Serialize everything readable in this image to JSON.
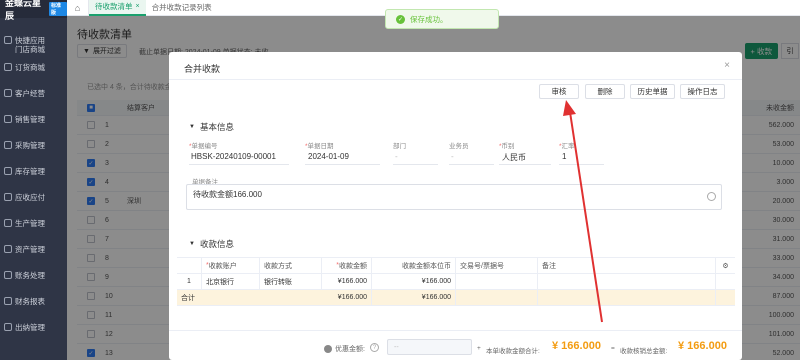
{
  "app": {
    "logo": "金蝶云星辰",
    "badge": "标准版"
  },
  "sidebar": {
    "items": [
      {
        "label": "快捷应用\n门店商城"
      },
      {
        "label": "订货商城"
      },
      {
        "label": "客户经营"
      },
      {
        "label": "销售管理"
      },
      {
        "label": "采购管理"
      },
      {
        "label": "库存管理"
      },
      {
        "label": "应收应付"
      },
      {
        "label": "生产管理"
      },
      {
        "label": "资产管理"
      },
      {
        "label": "账务处理"
      },
      {
        "label": "财务报表"
      },
      {
        "label": "出纳管理"
      }
    ]
  },
  "tabs": [
    {
      "label": "待收款清单",
      "close": "×"
    },
    {
      "label": "合并收款记录列表"
    }
  ],
  "toast": {
    "text": "保存成功。"
  },
  "background": {
    "title": "待收款清单",
    "expand_filter": "展开过滤",
    "filter_text": "截止单据日期: 2024-01-09  单据状态: 未收 ...",
    "add_btn": "+ 收款",
    "more_btn": "引",
    "selection_info": "已选中 4 条，合计待收款金额",
    "head": {
      "col_name": "结算客户",
      "col_amount": "未收金额"
    },
    "rows": [
      {
        "no": "1",
        "name": "",
        "amount": "562.000",
        "checked": false
      },
      {
        "no": "2",
        "name": "",
        "amount": "53.000",
        "checked": false
      },
      {
        "no": "3",
        "name": "",
        "amount": "10.000",
        "checked": true
      },
      {
        "no": "4",
        "name": "",
        "amount": "3.000",
        "checked": true
      },
      {
        "no": "5",
        "name": "深圳",
        "amount": "20.000",
        "checked": true
      },
      {
        "no": "6",
        "name": "",
        "amount": "30.000",
        "checked": false
      },
      {
        "no": "7",
        "name": "",
        "amount": "31.000",
        "checked": false
      },
      {
        "no": "8",
        "name": "",
        "amount": "33.000",
        "checked": false
      },
      {
        "no": "9",
        "name": "",
        "amount": "34.000",
        "checked": false
      },
      {
        "no": "10",
        "name": "",
        "amount": "87.000",
        "checked": false
      },
      {
        "no": "11",
        "name": "",
        "amount": "100.000",
        "checked": false
      },
      {
        "no": "12",
        "name": "",
        "amount": "101.000",
        "checked": false
      },
      {
        "no": "13",
        "name": "",
        "amount": "52.000",
        "checked": true
      }
    ]
  },
  "modal": {
    "title": "合并收款",
    "close": "×",
    "buttons": {
      "audit": "审核",
      "delete": "删除",
      "history": "历史单据",
      "log": "操作日志"
    },
    "basic_section": "基本信息",
    "fields": [
      {
        "label": "单据编号",
        "required": true,
        "value": "HBSK-20240109-00001"
      },
      {
        "label": "单据日期",
        "required": true,
        "value": "2024-01-09"
      },
      {
        "label": "部门",
        "required": false,
        "value": "-"
      },
      {
        "label": "业务员",
        "required": false,
        "value": "-"
      },
      {
        "label": "币别",
        "required": true,
        "value": "人民币"
      },
      {
        "label": "汇率",
        "required": true,
        "value": "1"
      }
    ],
    "remark_label": "单据备注",
    "remark_value": "待收款金额166.000",
    "receipt_section": "收款信息",
    "table": {
      "headers": [
        "",
        "收款账户",
        "收款方式",
        "收款金额",
        "收款金额本位币",
        "交易号/票据号",
        "备注"
      ],
      "required": [
        false,
        true,
        false,
        true,
        false,
        false,
        false
      ],
      "rows": [
        [
          "1",
          "北京银行",
          "银行转账",
          "¥166.000",
          "¥166.000",
          "",
          ""
        ]
      ],
      "total": {
        "label": "合计",
        "amount": "¥166.000",
        "amount_base": "¥166.000"
      }
    },
    "footer": {
      "discount_label": "优惠金额:",
      "discount_placeholder": "--",
      "sum_label": "本单收款金额合计:",
      "sum_value": "¥ 166.000",
      "verify_label": "收款核销总金额:",
      "verify_value": "¥ 166.000",
      "plus": "+",
      "equals": "="
    }
  },
  "colors": {
    "accent": "#1aa06d",
    "amount": "#f39c12",
    "arrow": "#e03131"
  }
}
